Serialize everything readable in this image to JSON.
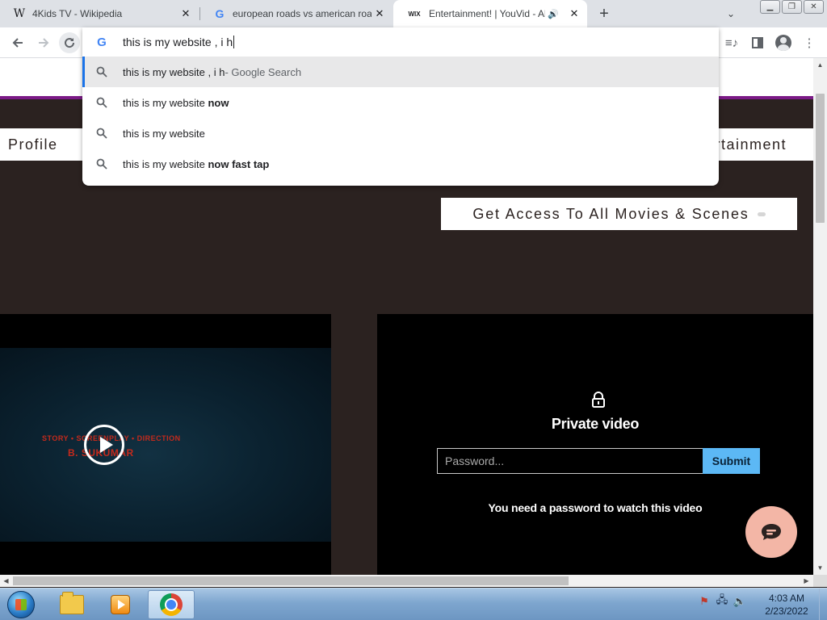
{
  "browser": {
    "tabs": [
      {
        "favicon": "W",
        "title": "4Kids TV - Wikipedia",
        "active": false
      },
      {
        "favicon": "G",
        "title": "european roads vs american roads",
        "active": false
      },
      {
        "favicon": "WIX",
        "title": "Entertainment! | YouVid - About",
        "active": true,
        "audio": true
      }
    ],
    "new_tab_label": "+",
    "omnibox": {
      "typed": "this is my website , i h",
      "suggestions": [
        {
          "text": "this is my website , i h",
          "bold": "",
          "hint": " - Google Search"
        },
        {
          "text": "this is my website ",
          "bold": "now",
          "hint": ""
        },
        {
          "text": "this is my website",
          "bold": "",
          "hint": ""
        },
        {
          "text": "this is my website ",
          "bold": "now fast tap",
          "hint": ""
        }
      ]
    }
  },
  "page": {
    "nav_left": "Profile",
    "nav_right": "ertainment",
    "access_button": "Get Access To All Movies & Scenes",
    "video_left": {
      "credit_line1": "STORY • SCREENPLAY • DIRECTION",
      "credit_line2": "B. SUKUMAR"
    },
    "private_video": {
      "title": "Private video",
      "password_placeholder": "Password...",
      "submit_label": "Submit",
      "note": "You need a password to watch this video"
    }
  },
  "taskbar": {
    "time": "4:03 AM",
    "date": "2/23/2022"
  },
  "colors": {
    "page_bg": "#2b2220",
    "header_accent": "#7b1a86",
    "submit_bg": "#5cb8f5",
    "chat_bg": "#f3b6a6"
  },
  "icons": {
    "back": "arrow-left-icon",
    "forward": "arrow-right-icon",
    "reload": "reload-icon",
    "search": "magnifier-icon",
    "lock": "lock-icon",
    "chat": "chat-bubble-icon"
  }
}
